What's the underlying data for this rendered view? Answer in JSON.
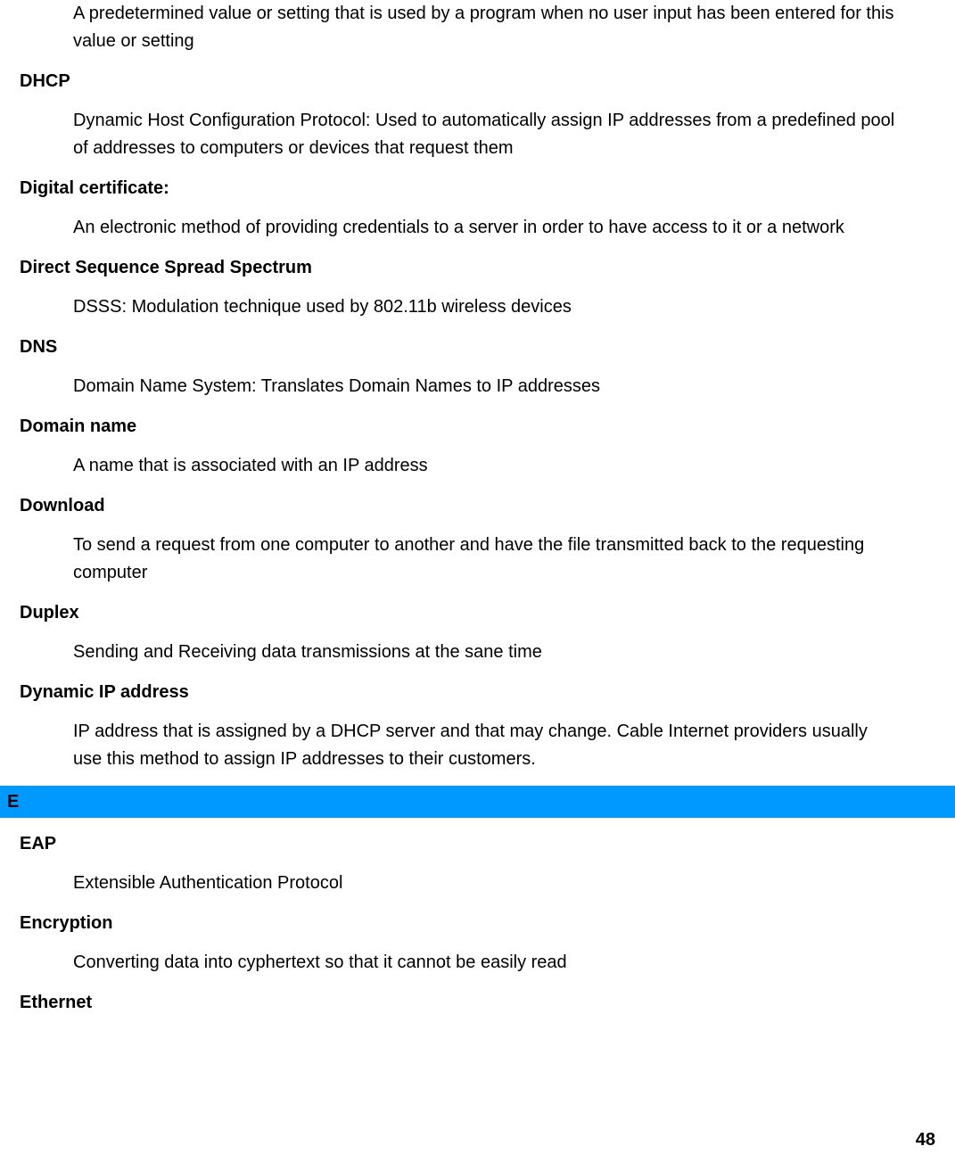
{
  "entries": [
    {
      "term": null,
      "definition": "A predetermined value or setting that is used by a program when no user input has been entered for this value or setting"
    },
    {
      "term": "DHCP",
      "definition": "Dynamic Host Configuration Protocol: Used to automatically assign IP addresses from a predefined pool of addresses to computers or devices that request them"
    },
    {
      "term": "Digital certificate:",
      "definition": "An electronic method of providing credentials to a server in order to have access to it or a network"
    },
    {
      "term": "Direct Sequence Spread Spectrum",
      "definition": "DSSS: Modulation technique used by 802.11b wireless devices"
    },
    {
      "term": "DNS",
      "definition": "Domain Name System: Translates Domain Names to IP addresses"
    },
    {
      "term": "Domain name",
      "definition": "A name that is associated with an IP address"
    },
    {
      "term": "Download",
      "definition": "To send a request from one computer to another and have the file transmitted back to the requesting computer"
    },
    {
      "term": "Duplex",
      "definition": "Sending and Receiving data transmissions at the sane time"
    },
    {
      "term": "Dynamic IP address",
      "definition": "IP address that is assigned by a DHCP server and that may change. Cable Internet providers usually use this method to assign IP addresses to their customers."
    }
  ],
  "section_header": "E",
  "entries_e": [
    {
      "term": "EAP",
      "definition": "Extensible Authentication Protocol"
    },
    {
      "term": "Encryption",
      "definition": "Converting data into cyphertext so that it cannot be easily read"
    },
    {
      "term": "Ethernet",
      "definition": null
    }
  ],
  "page_number": "48"
}
